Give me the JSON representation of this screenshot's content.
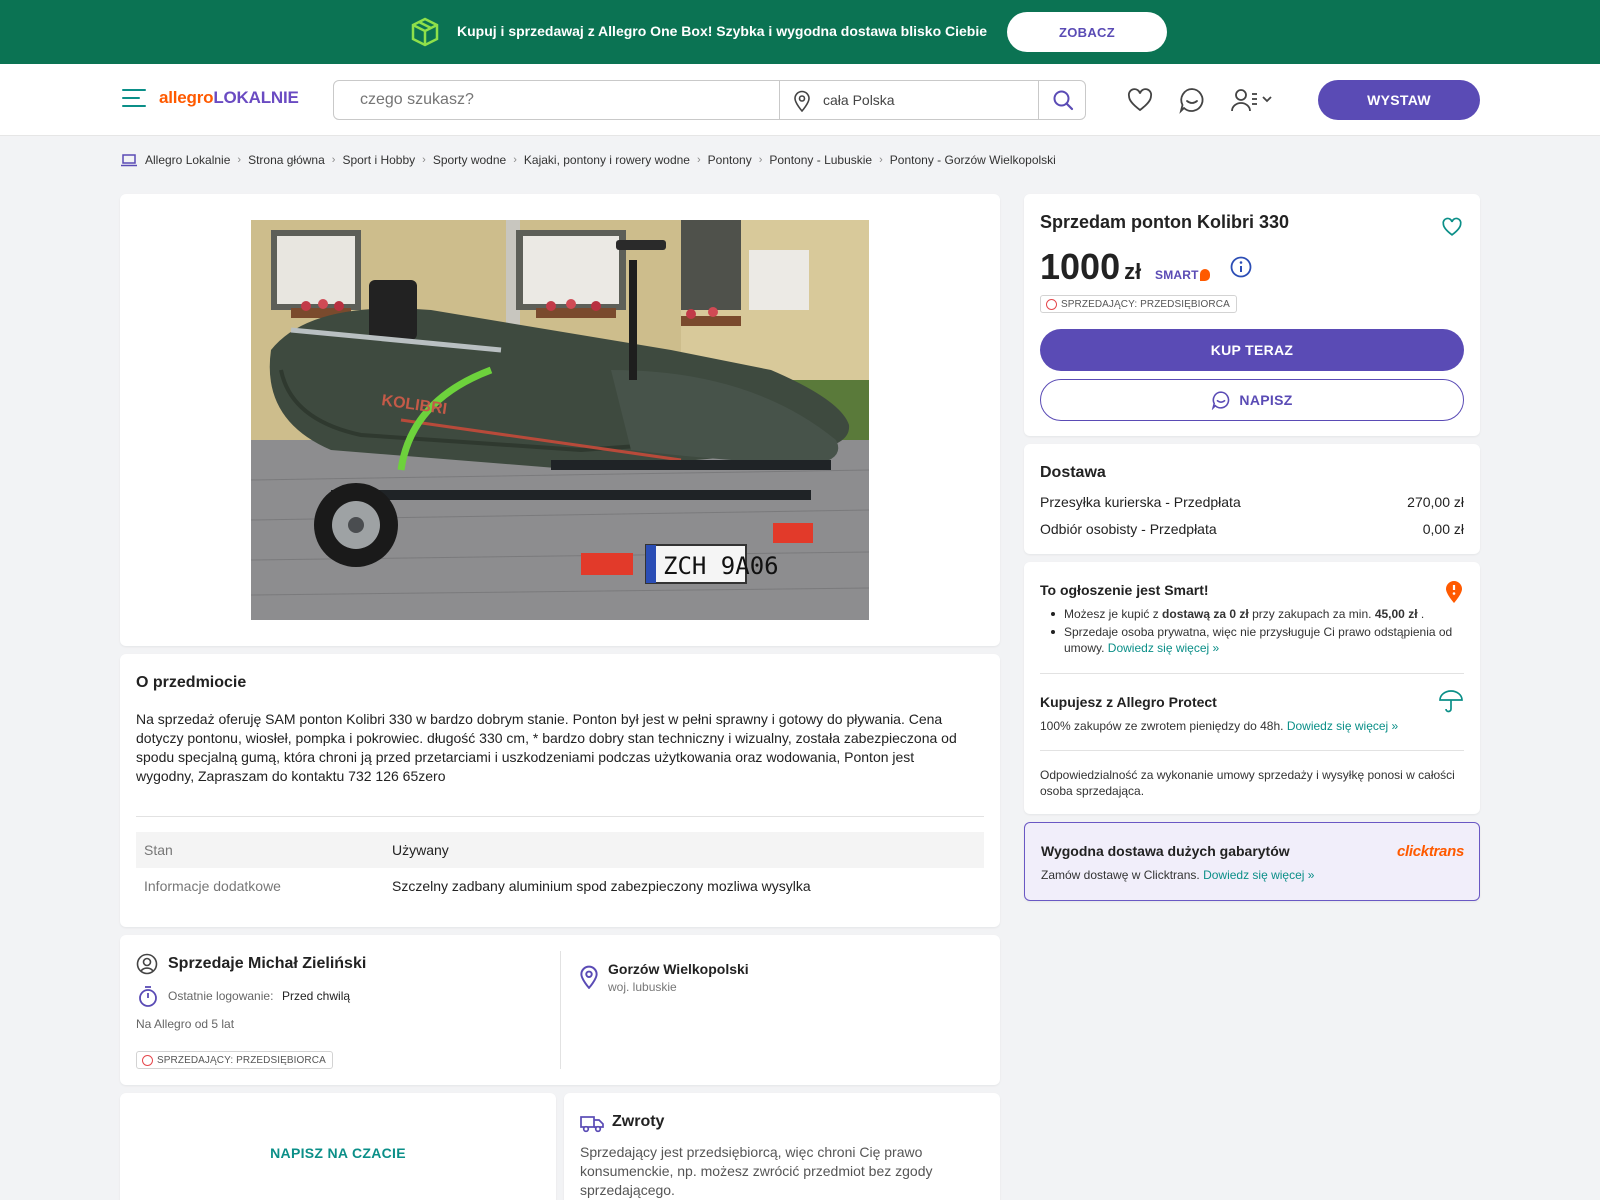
{
  "promo": {
    "text": "Kupuj i sprzedawaj z Allegro One Box! Szybka i wygodna dostawa blisko Ciebie",
    "button": "ZOBACZ",
    "accent": "#0b7353"
  },
  "header": {
    "logo_part1": "allegro",
    "logo_part2": "LOKALNIE",
    "search_placeholder": "czego szukasz?",
    "location": "cała Polska",
    "post_button": "WYSTAW",
    "brand_color": "#5a4bb5"
  },
  "breadcrumb": [
    "Allegro Lokalnie",
    "Strona główna",
    "Sport i Hobby",
    "Sporty wodne",
    "Kajaki, pontony i rowery wodne",
    "Pontony",
    "Pontony - Lubuskie",
    "Pontony - Gorzów Wielkopolski"
  ],
  "photo": {
    "plate": "ZCH 9A06",
    "brand_text": "KOLIBRI"
  },
  "about": {
    "title": "O przedmiocie",
    "description": "Na sprzedaż oferuję SAM ponton Kolibri 330 w bardzo dobrym stanie. Ponton był jest w pełni sprawny i gotowy do pływania. Cena dotyczy pontonu, wiosłeł, pompka i pokrowiec. długość 330 cm, * bardzo dobry stan techniczny i wizualny, została zabezpieczona od spodu specjalną gumą, która chroni ją przed przetarciami i uszkodzeniami podczas użytkowania oraz wodowania, Ponton jest wygodny, Zapraszam do kontaktu 732 126 65zero",
    "properties": [
      {
        "label": "Stan",
        "value": "Używany"
      },
      {
        "label": "Informacje dodatkowe",
        "value": "Szczelny zadbany aluminium spod zabezpieczony mozliwa wysylka"
      }
    ]
  },
  "seller": {
    "title": "Sprzedaje Michał Zieliński",
    "last_login_label": "Ostatnie logowanie:",
    "last_login_value": "Przed chwilą",
    "since": "Na Allegro od 5 lat",
    "badge": "SPRZEDAJĄCY: PRZEDSIĘBIORCA",
    "city": "Gorzów Wielkopolski",
    "region": "woj. lubuskie"
  },
  "chat": {
    "link": "NAPISZ NA CZACIE"
  },
  "returns": {
    "title": "Zwroty",
    "description": "Sprzedający jest przedsiębiorcą, więc chroni Cię prawo konsumenckie, np. możesz zwrócić przedmiot bez zgody sprzedającego."
  },
  "offer": {
    "title": "Sprzedam ponton Kolibri 330",
    "price": "1000",
    "currency": "zł",
    "smart": "SMART",
    "badge": "SPRZEDAJĄCY: PRZEDSIĘBIORCA",
    "buy_button": "KUP TERAZ",
    "message_button": "NAPISZ"
  },
  "delivery": {
    "title": "Dostawa",
    "options": [
      {
        "name": "Przesyłka kurierska - Przedpłata",
        "price": "270,00 zł"
      },
      {
        "name": "Odbiór osobisty - Przedpłata",
        "price": "0,00 zł"
      }
    ]
  },
  "smart_info": {
    "title": "To ogłoszenie jest Smart!",
    "bullet1_a": "Możesz je kupić z",
    "bullet1_b": "dostawą za 0 zł",
    "bullet1_c": "przy zakupach za min.",
    "bullet1_d": "45,00 zł",
    "bullet1_e": ".",
    "bullet2": "Sprzedaje osoba prywatna, więc nie przysługuje Ci prawo odstąpienia od umowy.",
    "learn_more": "Dowiedz się więcej »",
    "protect_title": "Kupujesz z Allegro Protect",
    "protect_text": "100% zakupów ze zwrotem pieniędzy do 48h.",
    "responsibility": "Odpowiedzialność za wykonanie umowy sprzedaży i wysyłkę ponosi w całości osoba sprzedająca."
  },
  "clicktrans": {
    "title": "Wygodna dostawa dużych gabarytów",
    "text": "Zamów dostawę w Clicktrans.",
    "learn_more": "Dowiedz się więcej »",
    "logo": "clicktrans"
  }
}
